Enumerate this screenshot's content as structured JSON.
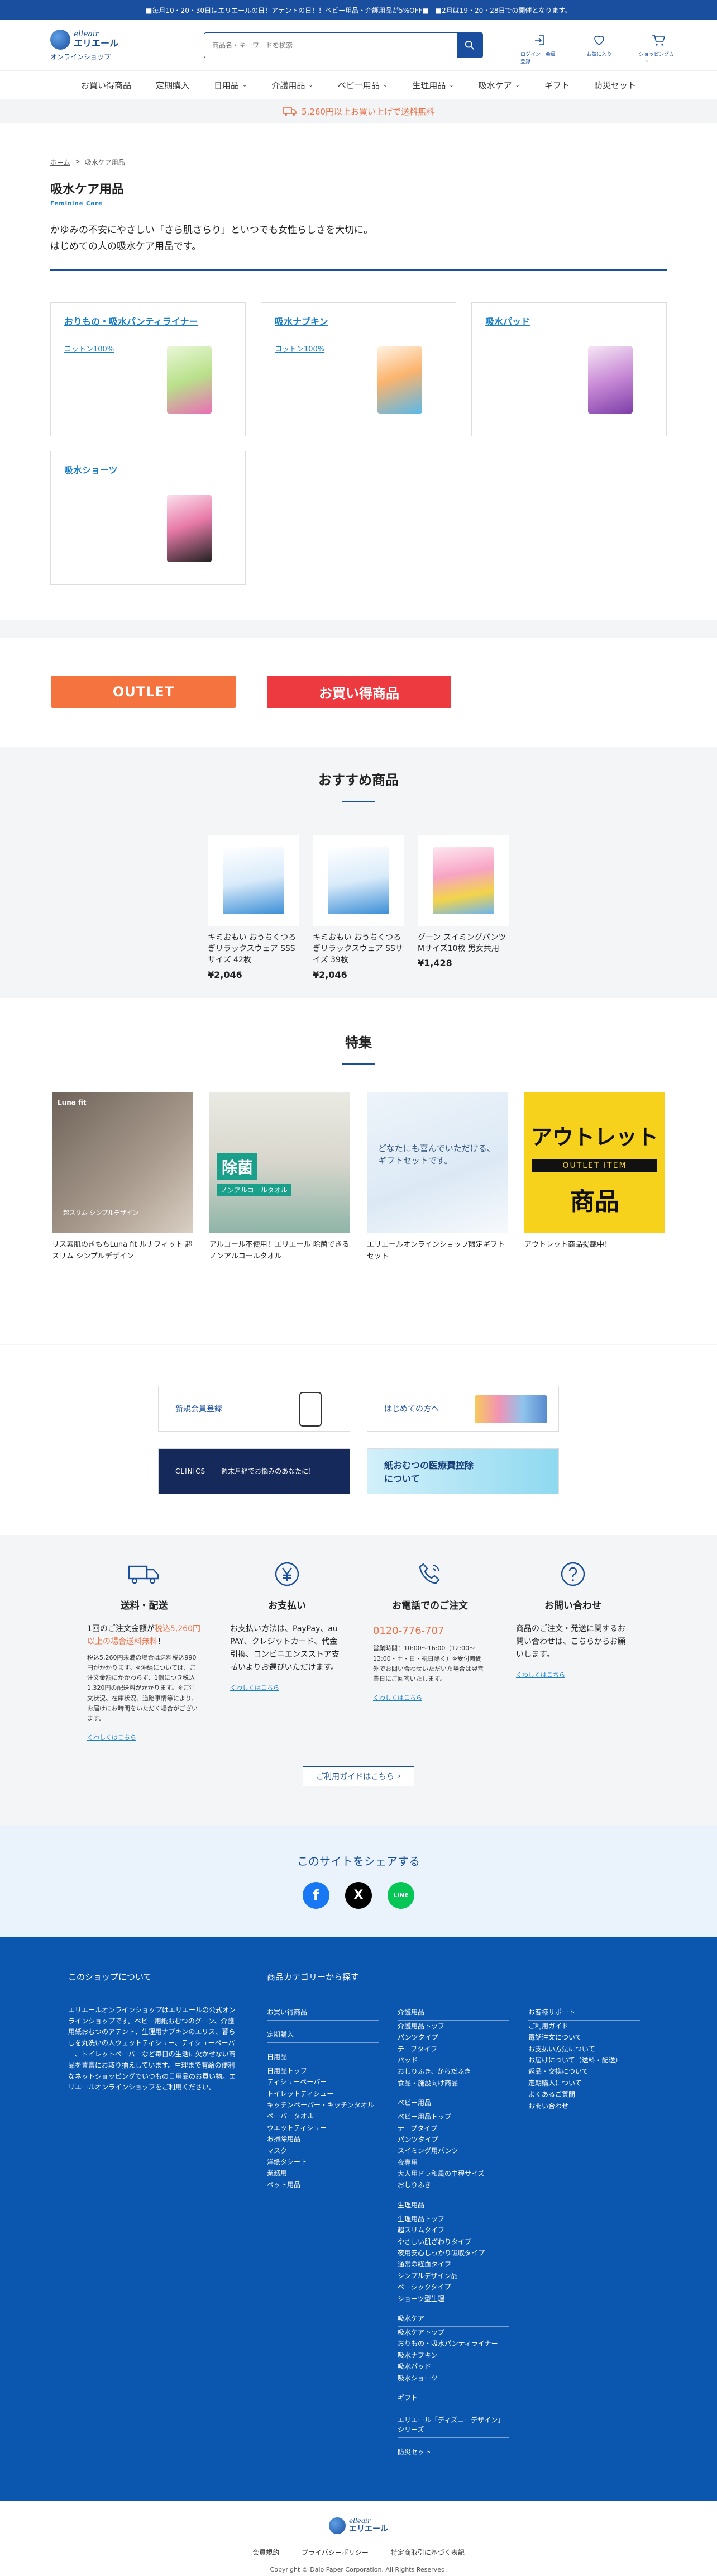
{
  "topbar": "■毎月10・20・30日はエリエールの日！アテントの日！！ベビー用品・介護用品が5%OFF■　■2月は19・20・28日での開催となります。",
  "header": {
    "logo_brand": "elleair",
    "logo_jp": "エリエール",
    "logo_sub": "オンラインショップ",
    "search_placeholder": "商品名・キーワードを検索",
    "actions": [
      {
        "label": "ログイン・会員登録",
        "icon": "login-icon"
      },
      {
        "label": "お気に入り",
        "icon": "heart-icon"
      },
      {
        "label": "ショッピングカート",
        "icon": "cart-icon"
      }
    ]
  },
  "nav": {
    "items": [
      {
        "label": "お買い得商品",
        "dropdown": false
      },
      {
        "label": "定期購入",
        "dropdown": false
      },
      {
        "label": "日用品",
        "dropdown": true
      },
      {
        "label": "介護用品",
        "dropdown": true
      },
      {
        "label": "ベビー用品",
        "dropdown": true
      },
      {
        "label": "生理用品",
        "dropdown": true
      },
      {
        "label": "吸水ケア",
        "dropdown": true
      },
      {
        "label": "ギフト",
        "dropdown": false
      },
      {
        "label": "防災セット",
        "dropdown": false
      }
    ],
    "chevron": "⌄"
  },
  "shipping_banner": "5,260円以上お買い上げで送料無料",
  "breadcrumb": {
    "home": "ホーム",
    "separator": ">",
    "current": "吸水ケア用品"
  },
  "page": {
    "title": "吸水ケア用品",
    "subtitle": "Feminine Care",
    "description_line1": "かゆみの不安にやさしい「さら肌さらり」といつでも女性らしさを大切に。",
    "description_line2": "はじめての人の吸水ケア用品です。"
  },
  "categories": [
    {
      "name": "おりもの・吸水パンティライナー",
      "sub": "コットン100%"
    },
    {
      "name": "吸水ナプキン",
      "sub": "コットン100%"
    },
    {
      "name": "吸水パッド",
      "sub": ""
    },
    {
      "name": "吸水ショーツ",
      "sub": ""
    }
  ],
  "buttons": {
    "outlet": "OUTLET",
    "deals": "お買い得商品"
  },
  "recommended": {
    "heading": "おすすめ商品",
    "items": [
      {
        "name": "キミおもい おうちくつろぎリラックスウェア SSSサイズ 42枚",
        "price": "¥2,046"
      },
      {
        "name": "キミおもい おうちくつろぎリラックスウェア SSサイズ 39枚",
        "price": "¥2,046"
      },
      {
        "name": "グーン スイミングパンツ Mサイズ10枚 男女共用",
        "price": "¥1,428"
      }
    ]
  },
  "features": {
    "heading": "特集",
    "items": [
      {
        "caption": "リス素肌のきもちLuna fit ルナフィット 超スリム シンプルデザイン",
        "img_brand": "Luna fit",
        "img_text": "超スリム シンプルデザイン"
      },
      {
        "caption": "アルコール不使用！エリエール 除菌できるノンアルコールタオル",
        "img_big": "除菌",
        "img_text": "ノンアルコールタオル"
      },
      {
        "caption": "エリエールオンラインショップ限定ギフトセット",
        "img_text": "どなたにも喜んでいただける、ギフトセットです。"
      },
      {
        "caption": "アウトレット商品掲載中！",
        "img_big": "アウトレット",
        "img_mid": "OUTLET ITEM",
        "img_low": "商品"
      }
    ]
  },
  "banners": [
    {
      "label": "新規会員登録"
    },
    {
      "label": "はじめての方へ"
    },
    {
      "label": "週末月経でお悩みのあなたに！",
      "sub": "CLINICS"
    },
    {
      "label": "紙おむつの医療費控除について"
    }
  ],
  "info": {
    "cols": [
      {
        "title": "送料・配送",
        "text_pre": "1回のご注文金額が",
        "text_accent": "税込5,260円以上の場合送料無料",
        "text_post": "！",
        "note": "税込5,260円未満の場合は送料税込990円がかかります。※沖縄については、ご注文金額にかかわらず、1個につき税込1,320円の配送料がかかります。※ご注文状況、在庫状況、道路事情等により、お届けにお時間をいただく場合がございます。",
        "link": "くわしくはこちら"
      },
      {
        "title": "お支払い",
        "text_pre": "お支払い方法は、PayPay、au PAY、クレジットカード、代金引換、コンビニエンスストア支払いよりお選びいただけます。",
        "text_accent": "",
        "text_post": "",
        "note": "",
        "link": "くわしくはこちら"
      },
      {
        "title": "お電話でのご注文",
        "text_pre": "",
        "text_accent": "0120-776-707",
        "text_post": "",
        "note": "営業時間：10:00〜16:00（12:00〜13:00・土・日・祝日除く）※受付時間外でお問い合わせいただいた場合は翌営業日にご回答いたします。",
        "link": "くわしくはこちら"
      },
      {
        "title": "お問い合わせ",
        "text_pre": "商品のご注文・発送に関するお問い合わせは、こちらからお願いします。",
        "text_accent": "",
        "text_post": "",
        "note": "",
        "link": "くわしくはこちら"
      }
    ],
    "guide": "ご利用ガイドはこちら",
    "guide_arrow": "›"
  },
  "share": {
    "title": "このサイトをシェアする",
    "facebook": "f",
    "x": "X",
    "line": "LINE"
  },
  "footer": {
    "about_title": "このショップについて",
    "about_text": "エリエールオンラインショップはエリエールの公式オンラインショップです。ベビー用紙おむつのグーン、介護用紙おむつのアテント、生理用ナプキンのエリス、暮らしを丸洗いの人ウェットティシュー、ティシューペーパー、トイレットペーパーなど毎日の生活に欠かせない商品を豊富にお取り揃えしています。生理まで有給の便利なネットショッピングでいつもの日用品のお買い物。エリエールオンラインショップをご利用ください。",
    "cats_title": "商品カテゴリーから探す",
    "col1": [
      {
        "heading": "お買い得商品",
        "items": []
      },
      {
        "heading": "定期購入",
        "items": []
      },
      {
        "heading": "日用品",
        "items": [
          "日用品トップ",
          "ティシューペーパー",
          "トイレットティシュー",
          "キッチンペーパー・キッチンタオル",
          "ペーパータオル",
          "ウエットティシュー",
          "お掃除用品",
          "マスク",
          "洋紙タシート",
          "業務用",
          "ペット用品"
        ]
      }
    ],
    "col2": [
      {
        "heading": "介護用品",
        "items": [
          "介護用品トップ",
          "パンツタイプ",
          "テープタイプ",
          "パッド",
          "おしりふき、からだふき",
          "食品・施設向け商品"
        ]
      },
      {
        "heading": "ベビー用品",
        "items": [
          "ベビー用品トップ",
          "テープタイプ",
          "パンツタイプ",
          "スイミング用パンツ",
          "夜専用",
          "大人用ドラ和風の中程サイズ",
          "おしりふき"
        ]
      },
      {
        "heading": "生理用品",
        "items": [
          "生理用品トップ",
          "超スリムタイプ",
          "やさしい肌ざわりタイプ",
          "夜用安心しっかり吸収タイプ",
          "通常の経血タイプ",
          "シンプルデザイン品",
          "ペーシックタイプ",
          "ショーツ型生理"
        ]
      },
      {
        "heading": "吸水ケア",
        "items": [
          "吸水ケアトップ",
          "おりもの・吸水パンティライナー",
          "吸水ナプキン",
          "吸水パッド",
          "吸水ショーツ"
        ]
      },
      {
        "heading": "ギフト",
        "items": []
      },
      {
        "heading": "エリエール「ディズニーデザイン」シリーズ",
        "items": []
      },
      {
        "heading": "防災セット",
        "items": []
      }
    ],
    "col3": [
      {
        "heading": "お客様サポート",
        "items": [
          "ご利用ガイド",
          "電話注文について",
          "お支払い方法について",
          "お届けについて（送料・配送）",
          "返品・交換について",
          "定期購入について",
          "よくあるご質問",
          "お問い合わせ"
        ]
      }
    ]
  },
  "footer_bottom": {
    "logo_brand": "elleair",
    "logo_jp": "エリエール",
    "links": [
      "会員規約",
      "プライバシーポリシー",
      "特定商取引に基づく表記"
    ],
    "copyright": "Copyright © Daio Paper Corporation. All Rights Reserved."
  },
  "colors": {
    "brand": "#1a4e9e",
    "accent": "#e8734a",
    "outlet": "#f4733e",
    "deals": "#ec3a40",
    "footer": "#0b57b0"
  }
}
